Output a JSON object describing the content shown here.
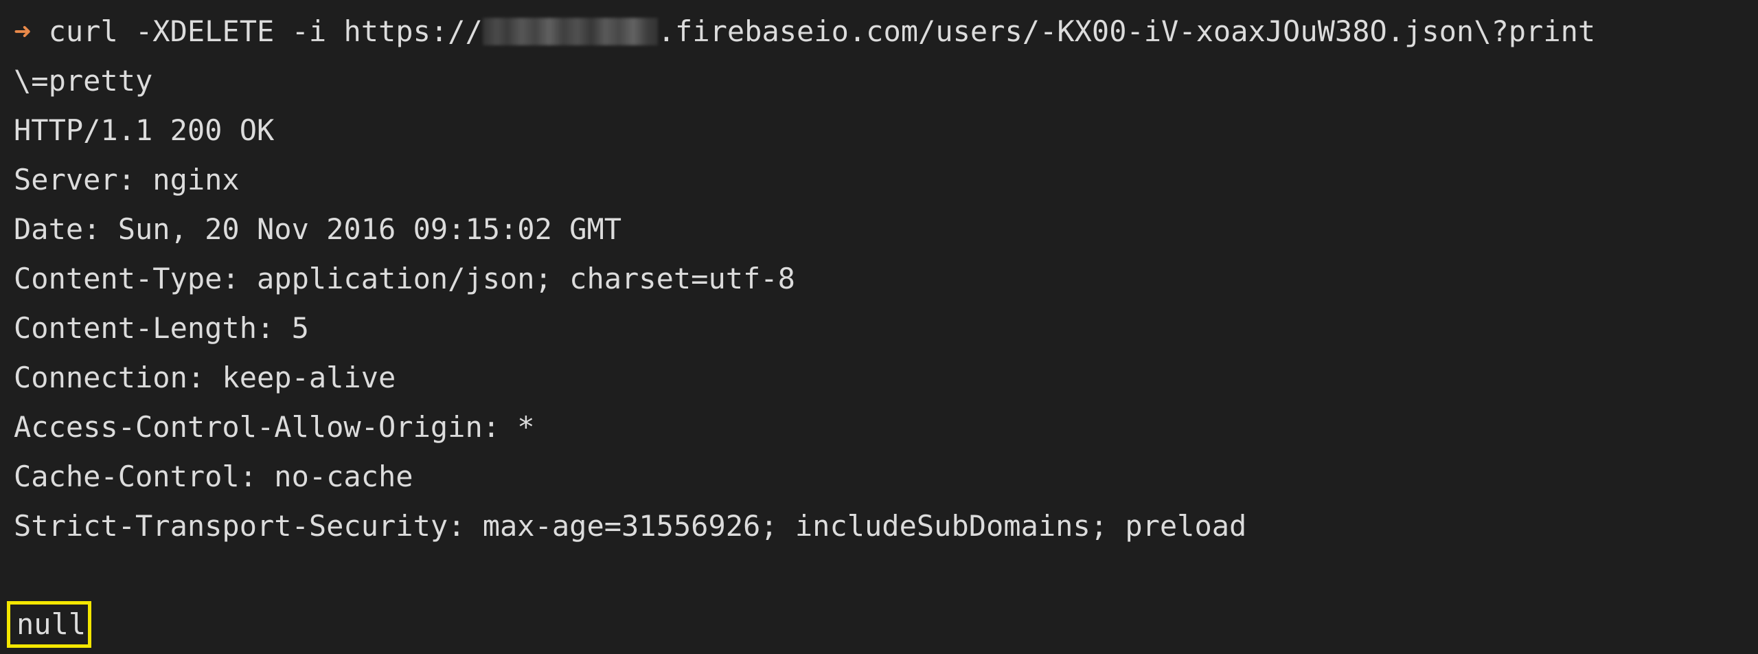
{
  "terminal": {
    "prompt_symbol": "➜",
    "command_prefix": " curl -XDELETE -i https://",
    "command_suffix": ".firebaseio.com/users/-KX00-iV-xoaxJOuW38O.json\\?print",
    "command_continuation": "\\=pretty",
    "response_lines": [
      "HTTP/1.1 200 OK",
      "Server: nginx",
      "Date: Sun, 20 Nov 2016 09:15:02 GMT",
      "Content-Type: application/json; charset=utf-8",
      "Content-Length: 5",
      "Connection: keep-alive",
      "Access-Control-Allow-Origin: *",
      "Cache-Control: no-cache",
      "Strict-Transport-Security: max-age=31556926; includeSubDomains; preload"
    ],
    "response_body": "null"
  },
  "colors": {
    "background": "#1e1e1e",
    "text": "#dcdcdc",
    "prompt": "#e8894a",
    "highlight_border": "#f3e600"
  }
}
